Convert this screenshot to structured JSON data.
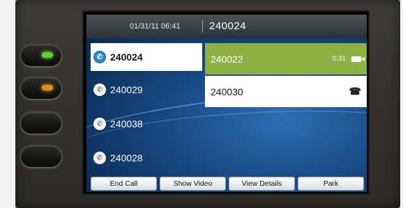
{
  "header": {
    "datetime": "01/31/11 06:41",
    "line": "240024"
  },
  "lines": [
    {
      "number": "240024",
      "state": "off-hook",
      "icon": "handset-offhook-icon"
    },
    {
      "number": "240029",
      "state": "on-hook",
      "icon": "handset-onhook-icon"
    },
    {
      "number": "240038",
      "state": "on-hook",
      "icon": "handset-onhook-icon"
    },
    {
      "number": "240028",
      "state": "on-hook",
      "icon": "handset-onhook-icon"
    }
  ],
  "calls": [
    {
      "number": "240022",
      "timer": "0:31",
      "state": "connected",
      "icon": "video-camera-icon",
      "color": "#8db243"
    },
    {
      "number": "240030",
      "state": "incoming",
      "icon": "ringing-icon"
    }
  ],
  "softkeys": {
    "end_call": "End Call",
    "show_video": "Show Video",
    "view_details": "View Details",
    "park": "Park"
  },
  "hardware_keys": [
    {
      "led": "green"
    },
    {
      "led": "amber"
    },
    {
      "led": "off"
    },
    {
      "led": "off"
    }
  ]
}
